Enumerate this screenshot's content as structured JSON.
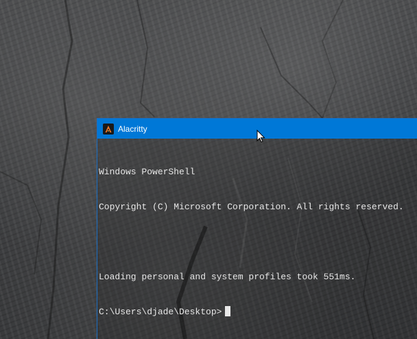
{
  "window": {
    "title": "Alacritty",
    "icon": "alacritty-icon",
    "accent_color": "#0078d7"
  },
  "terminal": {
    "lines": [
      "Windows PowerShell",
      "Copyright (C) Microsoft Corporation. All rights reserved.",
      "",
      "Loading personal and system profiles took 551ms.",
      "C:\\Users\\djade\\Desktop>"
    ],
    "text_color": "#e6e6e6"
  }
}
